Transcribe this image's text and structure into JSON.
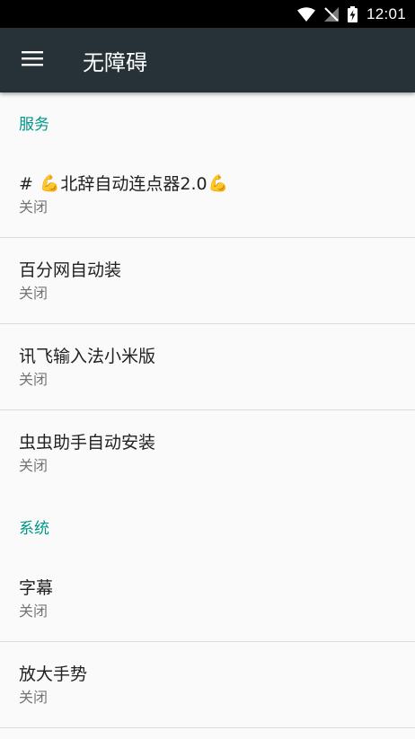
{
  "colors": {
    "status_bar": "#000000",
    "toolbar": "#263238",
    "accent": "#009688",
    "background": "#fafafa"
  },
  "status_bar": {
    "time": "12:01"
  },
  "toolbar": {
    "title": "无障碍"
  },
  "sections": [
    {
      "header": "服务",
      "items": [
        {
          "prefix": "# ",
          "title": "北辞自动连点器2.0",
          "emoji": "💪",
          "subtitle": "关闭"
        },
        {
          "title": "百分网自动装",
          "subtitle": "关闭"
        },
        {
          "title": "讯飞输入法小米版",
          "subtitle": "关闭"
        },
        {
          "title": "虫虫助手自动安装",
          "subtitle": "关闭"
        }
      ]
    },
    {
      "header": "系统",
      "items": [
        {
          "title": "字幕",
          "subtitle": "关闭"
        },
        {
          "title": "放大手势",
          "subtitle": "关闭"
        }
      ]
    }
  ]
}
